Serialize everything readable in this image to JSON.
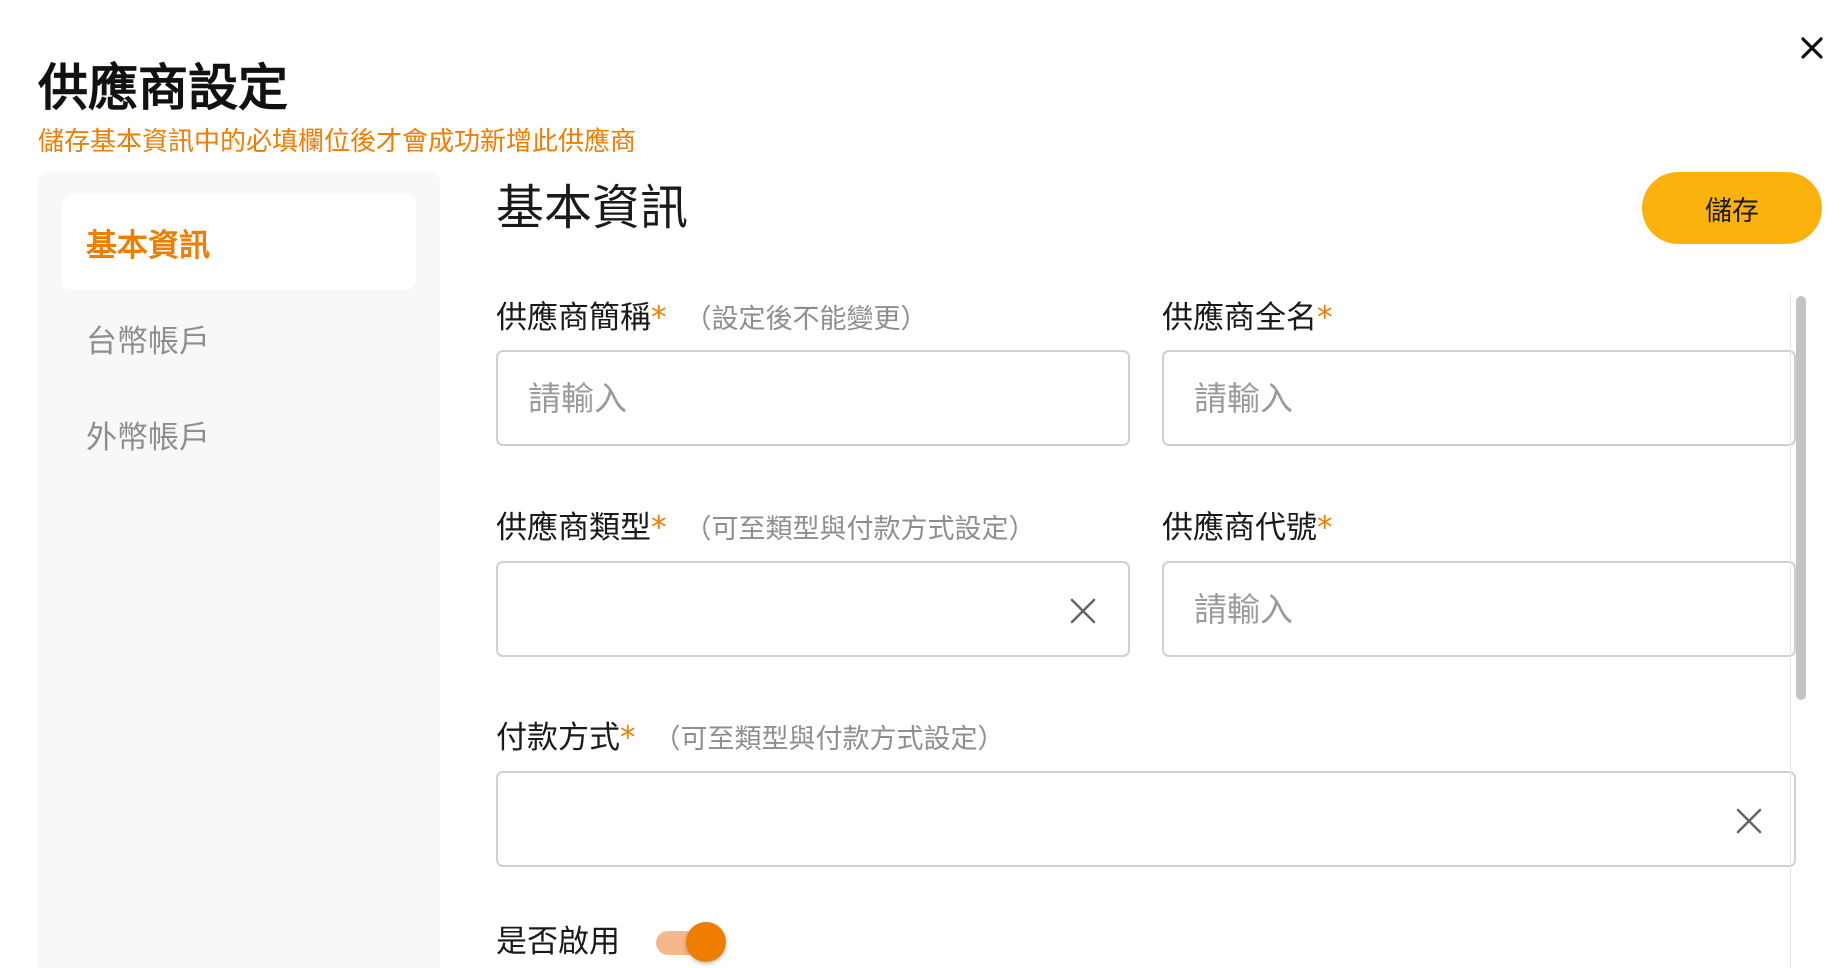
{
  "header": {
    "title": "供應商設定",
    "subtitle": "儲存基本資訊中的必填欄位後才會成功新增此供應商"
  },
  "sidebar": {
    "items": [
      {
        "label": "基本資訊",
        "active": true
      },
      {
        "label": "台幣帳戶",
        "active": false
      },
      {
        "label": "外幣帳戶",
        "active": false
      }
    ]
  },
  "main": {
    "section_title": "基本資訊",
    "save_label": "儲存",
    "fields": {
      "short_name": {
        "label": "供應商簡稱",
        "required": "*",
        "hint": "（設定後不能變更）",
        "placeholder": "請輸入",
        "value": ""
      },
      "full_name": {
        "label": "供應商全名",
        "required": "*",
        "placeholder": "請輸入",
        "value": ""
      },
      "vendor_type": {
        "label": "供應商類型",
        "required": "*",
        "hint": "（可至類型與付款方式設定）",
        "value": ""
      },
      "vendor_code": {
        "label": "供應商代號",
        "required": "*",
        "placeholder": "請輸入",
        "value": ""
      },
      "payment_method": {
        "label": "付款方式",
        "required": "*",
        "hint": "（可至類型與付款方式設定）",
        "value": ""
      }
    },
    "enable": {
      "label": "是否啟用",
      "on": true
    }
  },
  "colors": {
    "accent": "#ee7d00",
    "save_button": "#fbb20d",
    "toggle_track": "#f6b78a",
    "sidebar_bg": "#f8f8f8"
  },
  "icons": {
    "close": "close-icon",
    "clear": "clear-icon"
  }
}
